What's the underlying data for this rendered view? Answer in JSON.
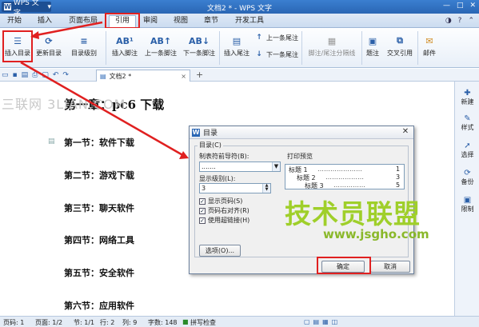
{
  "app": {
    "wps_button": "WPS 文字",
    "title": "文档2 * - WPS 文字",
    "controls": [
      "—",
      "□",
      "✕"
    ]
  },
  "menu": {
    "items": [
      "开始",
      "插入",
      "页面布局",
      "引用",
      "审阅",
      "视图",
      "章节",
      "开发工具"
    ],
    "active": "引用"
  },
  "ribbon": {
    "insert_toc": "插入目录",
    "update_toc": "更新目录",
    "toc_level": "目录级别",
    "insert_footnote": "插入脚注",
    "prev_footnote": "上一条脚注",
    "next_footnote": "下一条脚注",
    "insert_endnote": "插入尾注",
    "prev_endnote": "上一条尾注",
    "next_endnote": "下一条尾注",
    "footnote_sep": "脚注/尾注分隔线",
    "caption": "题注",
    "cross_ref": "交叉引用",
    "mail": "邮件"
  },
  "tabs": {
    "doc_tab": "文档2 *",
    "new_tab": "+"
  },
  "document": {
    "heading": "第一章：pc6 下载",
    "sections": [
      "第一节：软件下载",
      "第二节：游戏下载",
      "第三节：聊天软件",
      "第四节：网络工具",
      "第五节：安全软件",
      "第六节：应用软件"
    ]
  },
  "watermarks": {
    "left": "三联网 3LIAN.COM",
    "brand": "技术员联盟",
    "url": "www.jsgho.com"
  },
  "sidebar": [
    "新建",
    "样式",
    "选择",
    "备份",
    "限制"
  ],
  "status": {
    "page_no": "页码: 1",
    "pages": "页面: 1/2",
    "section": "节: 1/1",
    "row": "行: 2",
    "col": "列: 9",
    "words": "字数: 148",
    "spell": "拼写检查"
  },
  "dialog": {
    "title": "目录",
    "fieldset": "目录(C)",
    "leader_label": "制表符前导符(B):",
    "leader_value": ".......",
    "level_label": "显示级别(L):",
    "level_value": "3",
    "chk_page_num": "显示页码(S)",
    "chk_right_align": "页码右对齐(R)",
    "chk_hyperlink": "使用超链接(H)",
    "preview_label": "打印预览",
    "preview": [
      {
        "t": "标题 1",
        "p": "1"
      },
      {
        "t": "标题 2",
        "p": "3"
      },
      {
        "t": "标题 3",
        "p": "5"
      }
    ],
    "options": "选项(O)...",
    "ok": "确定",
    "cancel": "取消"
  }
}
